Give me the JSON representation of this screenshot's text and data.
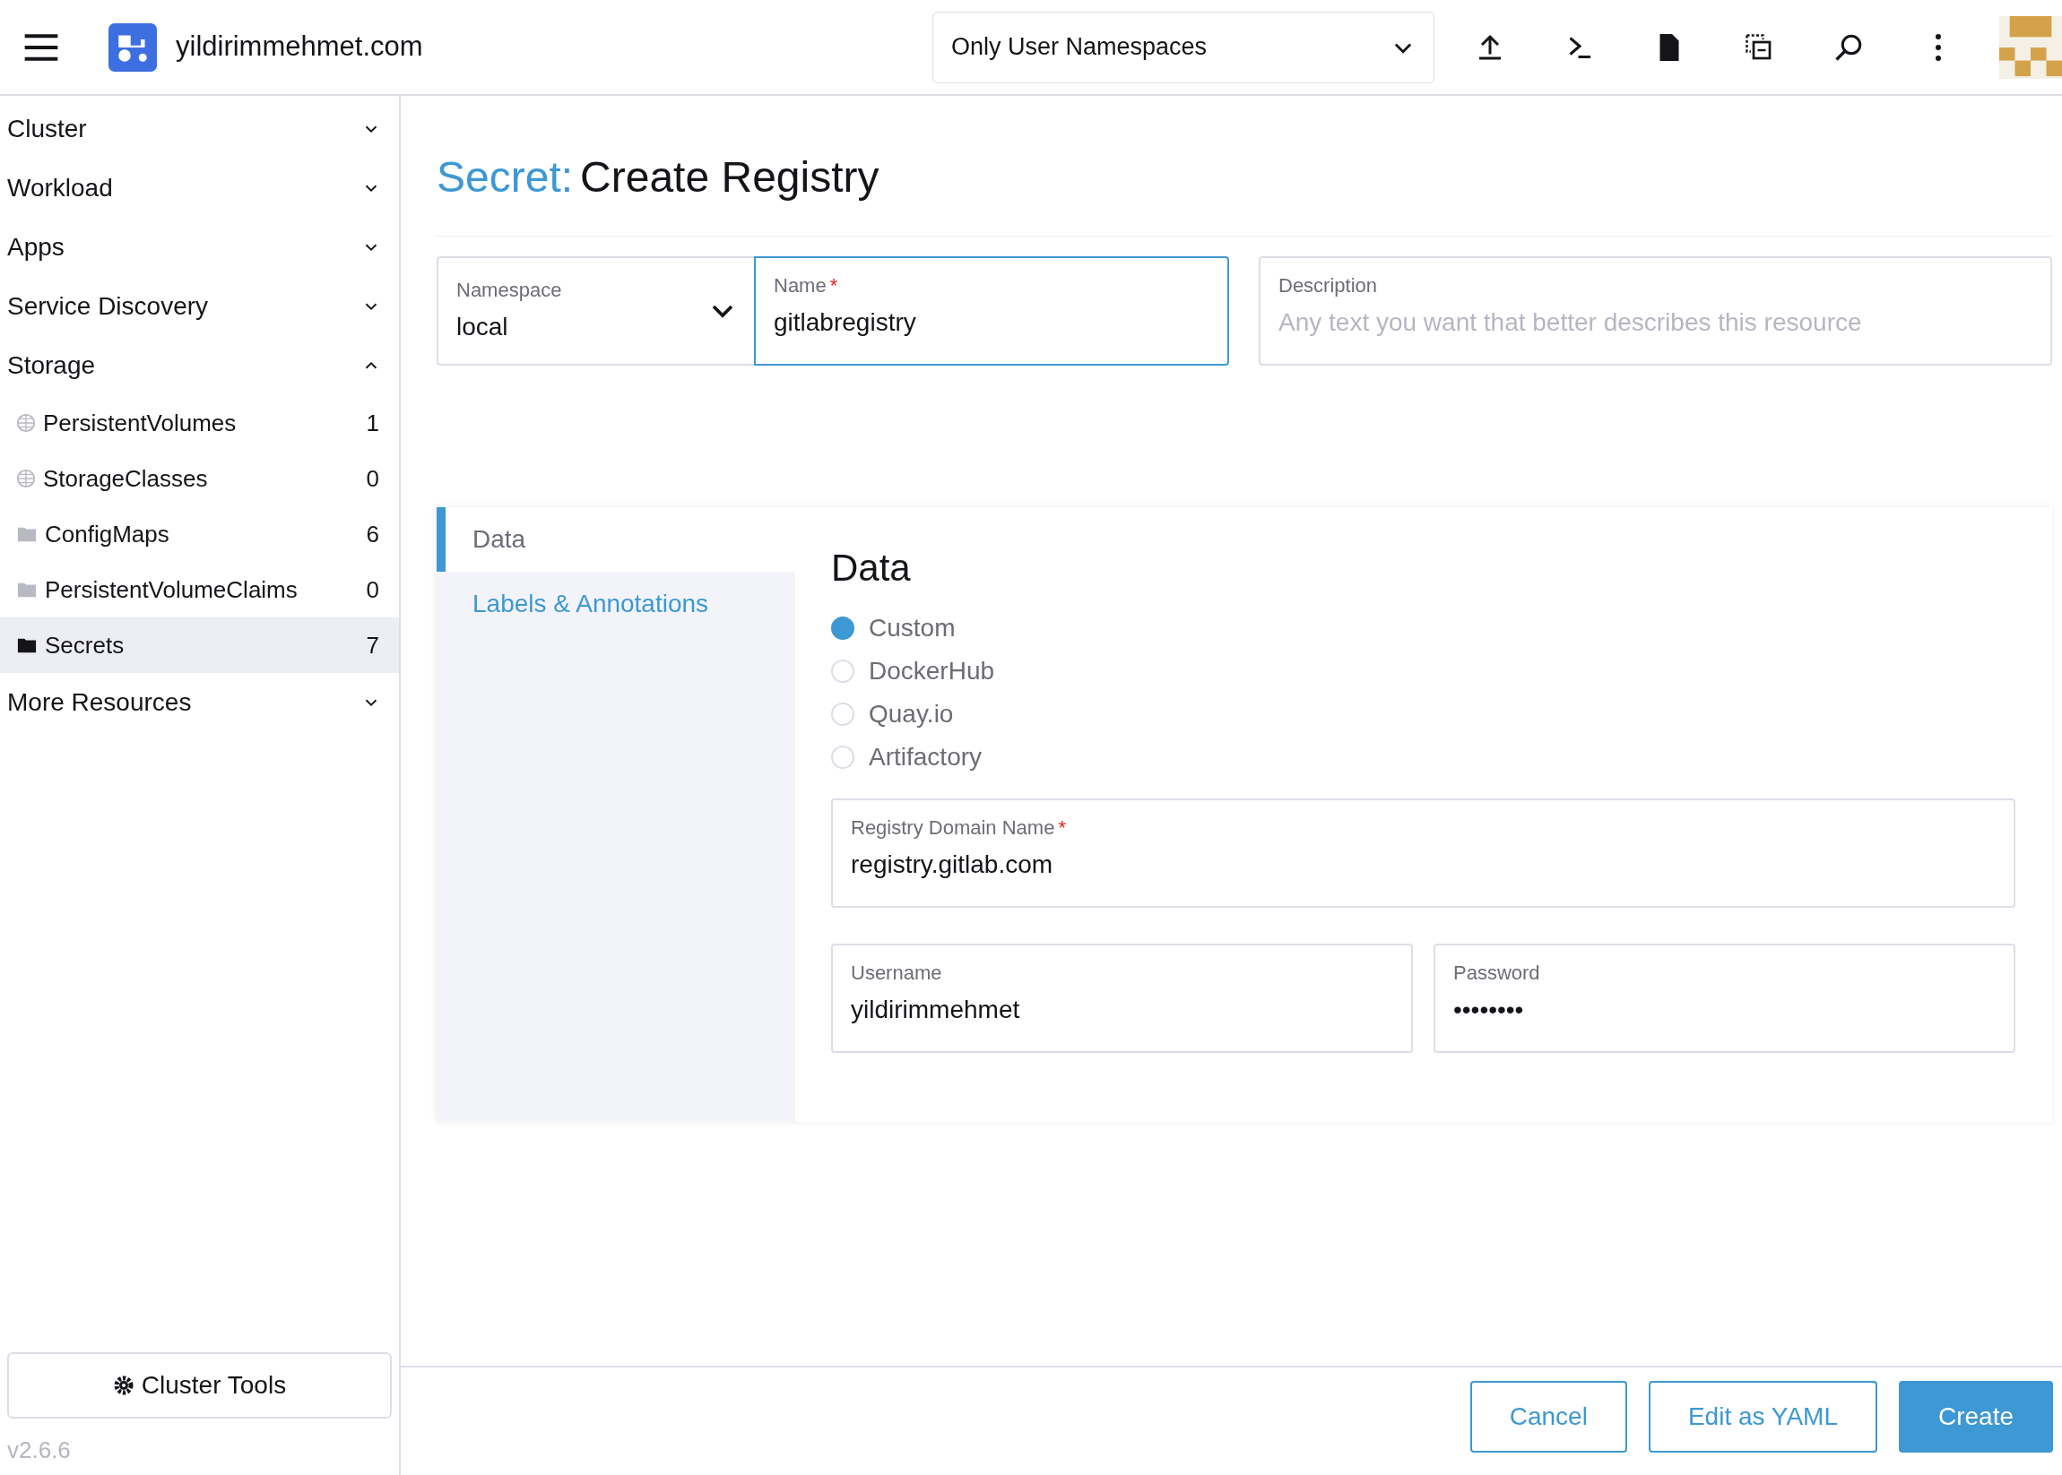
{
  "header": {
    "site": "yildirimmehmet.com",
    "namespace_filter": "Only User Namespaces"
  },
  "sidebar": {
    "groups": [
      {
        "label": "Cluster",
        "expanded": false
      },
      {
        "label": "Workload",
        "expanded": false
      },
      {
        "label": "Apps",
        "expanded": false
      },
      {
        "label": "Service Discovery",
        "expanded": false
      },
      {
        "label": "Storage",
        "expanded": true,
        "children": [
          {
            "label": "PersistentVolumes",
            "count": "1",
            "kind": "global",
            "selected": false
          },
          {
            "label": "StorageClasses",
            "count": "0",
            "kind": "global",
            "selected": false
          },
          {
            "label": "ConfigMaps",
            "count": "6",
            "kind": "namespaced",
            "selected": false
          },
          {
            "label": "PersistentVolumeClaims",
            "count": "0",
            "kind": "namespaced",
            "selected": false
          },
          {
            "label": "Secrets",
            "count": "7",
            "kind": "namespaced",
            "selected": true
          }
        ]
      },
      {
        "label": "More Resources",
        "expanded": false
      }
    ],
    "tools_button": "Cluster Tools",
    "version": "v2.6.6"
  },
  "title": {
    "prefix": "Secret:",
    "text": "Create Registry"
  },
  "namespace": {
    "label": "Namespace",
    "value": "local"
  },
  "name": {
    "label": "Name",
    "value": "gitlabregistry",
    "required_mark": "*",
    "focused": true
  },
  "description": {
    "label": "Description",
    "placeholder": "Any text you want that better describes this resource"
  },
  "tabs": [
    {
      "label": "Data",
      "selected": true
    },
    {
      "label": "Labels & Annotations",
      "selected": false
    }
  ],
  "section_title": "Data",
  "registry_types": [
    {
      "label": "Custom",
      "selected": true
    },
    {
      "label": "DockerHub",
      "selected": false
    },
    {
      "label": "Quay.io",
      "selected": false
    },
    {
      "label": "Artifactory",
      "selected": false
    }
  ],
  "registry_domain": {
    "label": "Registry Domain Name",
    "value": "registry.gitlab.com",
    "required_mark": "*"
  },
  "username": {
    "label": "Username",
    "value": "yildirimmehmet"
  },
  "password": {
    "label": "Password",
    "value": "••••••••"
  },
  "buttons": [
    {
      "label": "Cancel",
      "kind": "outline"
    },
    {
      "label": "Edit as YAML",
      "kind": "outline"
    },
    {
      "label": "Create",
      "kind": "primary"
    }
  ]
}
